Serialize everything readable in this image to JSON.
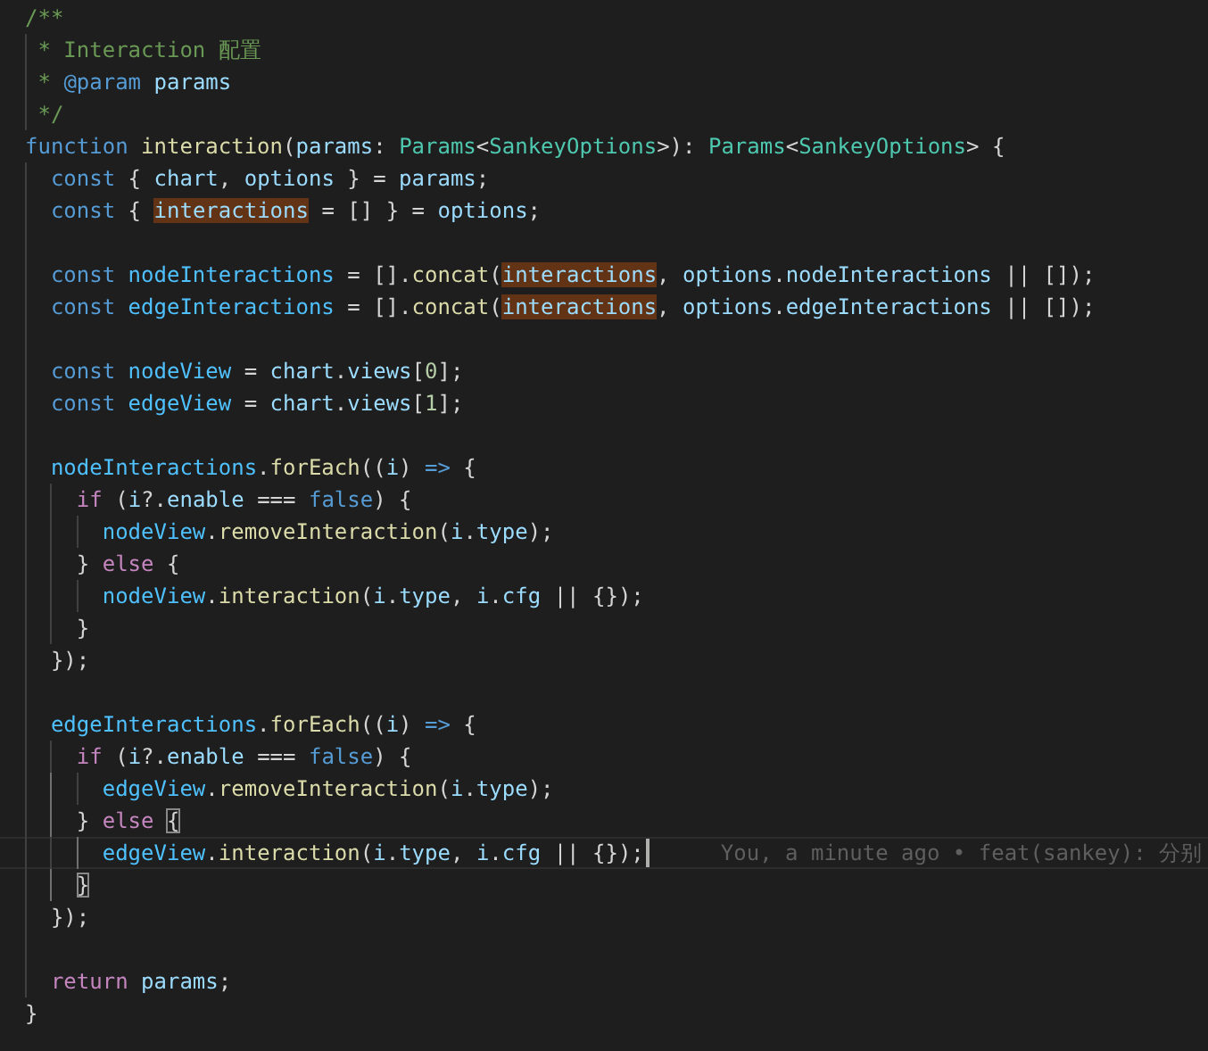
{
  "editor": {
    "lines": [
      {
        "current": false,
        "tokens": [
          {
            "text": "/**",
            "kind": "comment"
          }
        ]
      },
      {
        "current": false,
        "guides": [
          false
        ],
        "tokens": [
          {
            "text": " * Interaction 配置",
            "kind": "comment"
          }
        ]
      },
      {
        "current": false,
        "guides": [
          false
        ],
        "tokens": [
          {
            "text": " * ",
            "kind": "comment"
          },
          {
            "text": "@param",
            "kind": "doc-tag"
          },
          {
            "text": " params",
            "kind": "doc-param"
          }
        ]
      },
      {
        "current": false,
        "guides": [
          false
        ],
        "tokens": [
          {
            "text": " */",
            "kind": "comment"
          }
        ]
      },
      {
        "current": false,
        "tokens": [
          {
            "text": "function ",
            "kind": "keyword"
          },
          {
            "text": "interaction",
            "kind": "function"
          },
          {
            "text": "(",
            "kind": "punct"
          },
          {
            "text": "params",
            "kind": "variable"
          },
          {
            "text": ": ",
            "kind": "punct"
          },
          {
            "text": "Params",
            "kind": "type"
          },
          {
            "text": "<",
            "kind": "punct"
          },
          {
            "text": "SankeyOptions",
            "kind": "type"
          },
          {
            "text": ">): ",
            "kind": "punct"
          },
          {
            "text": "Params",
            "kind": "type"
          },
          {
            "text": "<",
            "kind": "punct"
          },
          {
            "text": "SankeyOptions",
            "kind": "type"
          },
          {
            "text": "> {",
            "kind": "punct"
          }
        ]
      },
      {
        "current": false,
        "guides": [
          false
        ],
        "tokens": [
          {
            "text": "  const",
            "kind": "keyword"
          },
          {
            "text": " { ",
            "kind": "punct"
          },
          {
            "text": "chart",
            "kind": "variable"
          },
          {
            "text": ", ",
            "kind": "punct"
          },
          {
            "text": "options",
            "kind": "variable"
          },
          {
            "text": " } = ",
            "kind": "punct"
          },
          {
            "text": "params",
            "kind": "variable"
          },
          {
            "text": ";",
            "kind": "punct"
          }
        ]
      },
      {
        "current": false,
        "guides": [
          false
        ],
        "tokens": [
          {
            "text": "  const",
            "kind": "keyword"
          },
          {
            "text": " { ",
            "kind": "punct"
          },
          {
            "text": "interactions",
            "kind": "highlight"
          },
          {
            "text": " = [] } = ",
            "kind": "punct"
          },
          {
            "text": "options",
            "kind": "variable"
          },
          {
            "text": ";",
            "kind": "punct"
          }
        ]
      },
      {
        "current": false,
        "guides": [
          false
        ]
      },
      {
        "current": false,
        "guides": [
          false
        ],
        "tokens": [
          {
            "text": "  const ",
            "kind": "keyword"
          },
          {
            "text": "nodeInteractions",
            "kind": "constant"
          },
          {
            "text": " = [].",
            "kind": "punct"
          },
          {
            "text": "concat",
            "kind": "function"
          },
          {
            "text": "(",
            "kind": "punct"
          },
          {
            "text": "interactions",
            "kind": "highlight"
          },
          {
            "text": ", ",
            "kind": "punct"
          },
          {
            "text": "options",
            "kind": "variable"
          },
          {
            "text": ".",
            "kind": "punct"
          },
          {
            "text": "nodeInteractions",
            "kind": "variable"
          },
          {
            "text": " || []);",
            "kind": "punct"
          }
        ]
      },
      {
        "current": false,
        "guides": [
          false
        ],
        "tokens": [
          {
            "text": "  const ",
            "kind": "keyword"
          },
          {
            "text": "edgeInteractions",
            "kind": "constant"
          },
          {
            "text": " = [].",
            "kind": "punct"
          },
          {
            "text": "concat",
            "kind": "function"
          },
          {
            "text": "(",
            "kind": "punct"
          },
          {
            "text": "interactions",
            "kind": "highlight"
          },
          {
            "text": ", ",
            "kind": "punct"
          },
          {
            "text": "options",
            "kind": "variable"
          },
          {
            "text": ".",
            "kind": "punct"
          },
          {
            "text": "edgeInteractions",
            "kind": "variable"
          },
          {
            "text": " || []);",
            "kind": "punct"
          }
        ]
      },
      {
        "current": false,
        "guides": [
          false
        ]
      },
      {
        "current": false,
        "guides": [
          false
        ],
        "tokens": [
          {
            "text": "  const ",
            "kind": "keyword"
          },
          {
            "text": "nodeView",
            "kind": "constant"
          },
          {
            "text": " = ",
            "kind": "punct"
          },
          {
            "text": "chart",
            "kind": "variable"
          },
          {
            "text": ".",
            "kind": "punct"
          },
          {
            "text": "views",
            "kind": "variable"
          },
          {
            "text": "[",
            "kind": "punct"
          },
          {
            "text": "0",
            "kind": "number"
          },
          {
            "text": "];",
            "kind": "punct"
          }
        ]
      },
      {
        "current": false,
        "guides": [
          false
        ],
        "tokens": [
          {
            "text": "  const ",
            "kind": "keyword"
          },
          {
            "text": "edgeView",
            "kind": "constant"
          },
          {
            "text": " = ",
            "kind": "punct"
          },
          {
            "text": "chart",
            "kind": "variable"
          },
          {
            "text": ".",
            "kind": "punct"
          },
          {
            "text": "views",
            "kind": "variable"
          },
          {
            "text": "[",
            "kind": "punct"
          },
          {
            "text": "1",
            "kind": "number"
          },
          {
            "text": "];",
            "kind": "punct"
          }
        ]
      },
      {
        "current": false,
        "guides": [
          false
        ]
      },
      {
        "current": false,
        "guides": [
          false
        ],
        "tokens": [
          {
            "text": "  nodeInteractions",
            "kind": "constant"
          },
          {
            "text": ".",
            "kind": "punct"
          },
          {
            "text": "forEach",
            "kind": "function"
          },
          {
            "text": "((",
            "kind": "punct"
          },
          {
            "text": "i",
            "kind": "variable"
          },
          {
            "text": ") ",
            "kind": "punct"
          },
          {
            "text": "=>",
            "kind": "keyword"
          },
          {
            "text": " {",
            "kind": "punct"
          }
        ]
      },
      {
        "current": false,
        "guides": [
          false,
          false
        ],
        "tokens": [
          {
            "text": "    if",
            "kind": "control"
          },
          {
            "text": " (",
            "kind": "punct"
          },
          {
            "text": "i",
            "kind": "variable"
          },
          {
            "text": "?.",
            "kind": "punct"
          },
          {
            "text": "enable",
            "kind": "variable"
          },
          {
            "text": " === ",
            "kind": "punct"
          },
          {
            "text": "false",
            "kind": "keyword"
          },
          {
            "text": ") {",
            "kind": "punct"
          }
        ]
      },
      {
        "current": false,
        "guides": [
          false,
          false,
          false
        ],
        "tokens": [
          {
            "text": "      nodeView",
            "kind": "constant"
          },
          {
            "text": ".",
            "kind": "punct"
          },
          {
            "text": "removeInteraction",
            "kind": "function"
          },
          {
            "text": "(",
            "kind": "punct"
          },
          {
            "text": "i",
            "kind": "variable"
          },
          {
            "text": ".",
            "kind": "punct"
          },
          {
            "text": "type",
            "kind": "variable"
          },
          {
            "text": ");",
            "kind": "punct"
          }
        ]
      },
      {
        "current": false,
        "guides": [
          false,
          false
        ],
        "tokens": [
          {
            "text": "    } ",
            "kind": "punct"
          },
          {
            "text": "else",
            "kind": "control"
          },
          {
            "text": " {",
            "kind": "punct"
          }
        ]
      },
      {
        "current": false,
        "guides": [
          false,
          false,
          false
        ],
        "tokens": [
          {
            "text": "      nodeView",
            "kind": "constant"
          },
          {
            "text": ".",
            "kind": "punct"
          },
          {
            "text": "interaction",
            "kind": "function"
          },
          {
            "text": "(",
            "kind": "punct"
          },
          {
            "text": "i",
            "kind": "variable"
          },
          {
            "text": ".",
            "kind": "punct"
          },
          {
            "text": "type",
            "kind": "variable"
          },
          {
            "text": ", ",
            "kind": "punct"
          },
          {
            "text": "i",
            "kind": "variable"
          },
          {
            "text": ".",
            "kind": "punct"
          },
          {
            "text": "cfg",
            "kind": "variable"
          },
          {
            "text": " || {});",
            "kind": "punct"
          }
        ]
      },
      {
        "current": false,
        "guides": [
          false,
          false
        ],
        "tokens": [
          {
            "text": "    }",
            "kind": "punct"
          }
        ]
      },
      {
        "current": false,
        "guides": [
          false
        ],
        "tokens": [
          {
            "text": "  });",
            "kind": "punct"
          }
        ]
      },
      {
        "current": false,
        "guides": [
          false
        ]
      },
      {
        "current": false,
        "guides": [
          false
        ],
        "tokens": [
          {
            "text": "  edgeInteractions",
            "kind": "constant"
          },
          {
            "text": ".",
            "kind": "punct"
          },
          {
            "text": "forEach",
            "kind": "function"
          },
          {
            "text": "((",
            "kind": "punct"
          },
          {
            "text": "i",
            "kind": "variable"
          },
          {
            "text": ") ",
            "kind": "punct"
          },
          {
            "text": "=>",
            "kind": "keyword"
          },
          {
            "text": " {",
            "kind": "punct"
          }
        ]
      },
      {
        "current": false,
        "guides": [
          false,
          false
        ],
        "tokens": [
          {
            "text": "    if",
            "kind": "control"
          },
          {
            "text": " (",
            "kind": "punct"
          },
          {
            "text": "i",
            "kind": "variable"
          },
          {
            "text": "?.",
            "kind": "punct"
          },
          {
            "text": "enable",
            "kind": "variable"
          },
          {
            "text": " === ",
            "kind": "punct"
          },
          {
            "text": "false",
            "kind": "keyword"
          },
          {
            "text": ") {",
            "kind": "punct"
          }
        ]
      },
      {
        "current": false,
        "guides": [
          false,
          true,
          false
        ],
        "tokens": [
          {
            "text": "      edgeView",
            "kind": "constant"
          },
          {
            "text": ".",
            "kind": "punct"
          },
          {
            "text": "removeInteraction",
            "kind": "function"
          },
          {
            "text": "(",
            "kind": "punct"
          },
          {
            "text": "i",
            "kind": "variable"
          },
          {
            "text": ".",
            "kind": "punct"
          },
          {
            "text": "type",
            "kind": "variable"
          },
          {
            "text": ");",
            "kind": "punct"
          }
        ]
      },
      {
        "current": false,
        "guides": [
          false,
          true
        ],
        "tokens": [
          {
            "text": "    } ",
            "kind": "punct"
          },
          {
            "text": "else ",
            "kind": "control"
          },
          {
            "text": "{",
            "kind": "bracket-match"
          }
        ]
      },
      {
        "current": true,
        "blame": "You, a minute ago • feat(sankey): 分别",
        "guides": [
          false,
          false,
          true
        ],
        "tokens": [
          {
            "text": "      edgeView",
            "kind": "constant"
          },
          {
            "text": ".",
            "kind": "punct"
          },
          {
            "text": "interaction",
            "kind": "function"
          },
          {
            "text": "(",
            "kind": "punct"
          },
          {
            "text": "i",
            "kind": "variable"
          },
          {
            "text": ".",
            "kind": "punct"
          },
          {
            "text": "type",
            "kind": "variable"
          },
          {
            "text": ", ",
            "kind": "punct"
          },
          {
            "text": "i",
            "kind": "variable"
          },
          {
            "text": ".",
            "kind": "punct"
          },
          {
            "text": "cfg",
            "kind": "variable"
          },
          {
            "text": " || {});",
            "kind": "punct"
          }
        ]
      },
      {
        "current": false,
        "guides": [
          false,
          true
        ],
        "tokens": [
          {
            "text": "    }",
            "kind": "bracket-match"
          }
        ]
      },
      {
        "current": false,
        "guides": [
          false
        ],
        "tokens": [
          {
            "text": "  });",
            "kind": "punct"
          }
        ]
      },
      {
        "current": false,
        "guides": [
          false
        ]
      },
      {
        "current": false,
        "guides": [
          false
        ],
        "tokens": [
          {
            "text": "  return ",
            "kind": "control"
          },
          {
            "text": "params",
            "kind": "variable"
          },
          {
            "text": ";",
            "kind": "punct"
          }
        ]
      },
      {
        "current": false,
        "tokens": [
          {
            "text": "}",
            "kind": "punct"
          }
        ]
      }
    ]
  }
}
